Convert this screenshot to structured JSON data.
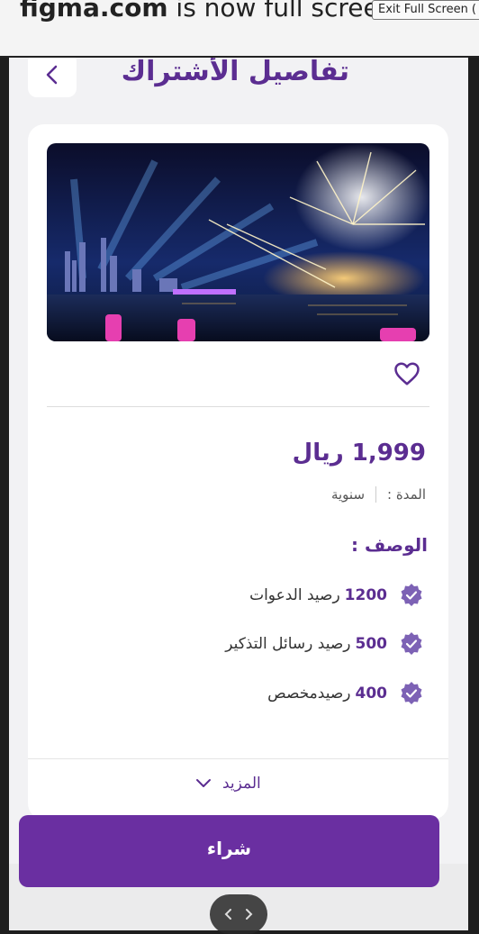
{
  "banner": {
    "domain": "figma.com",
    "message": " is now full screen",
    "exit_label": "Exit Full Screen ("
  },
  "header": {
    "title": "تفاصيل الأشتراك"
  },
  "card": {
    "image_description": "fireworks-over-harbor",
    "price": "1,999 ريال",
    "duration_label": "المدة :",
    "duration_value": "سنوية",
    "description_heading": "الوصف :",
    "features": [
      {
        "number": "1200",
        "text": "رصيد الدعوات"
      },
      {
        "number": "500",
        "text": "رصيد رسائل التذكير"
      },
      {
        "number": "400",
        "text": "رصيدمخصص"
      }
    ],
    "more_label": "المزيد"
  },
  "footer": {
    "buy_label": "شراء"
  },
  "colors": {
    "accent": "#5b2d91",
    "button": "#6a2fa1",
    "check": "#7d62b5"
  },
  "icons": [
    "chevron-left-icon",
    "heart-icon",
    "verified-check-icon",
    "chevron-down-icon",
    "drag-handle-icon"
  ]
}
